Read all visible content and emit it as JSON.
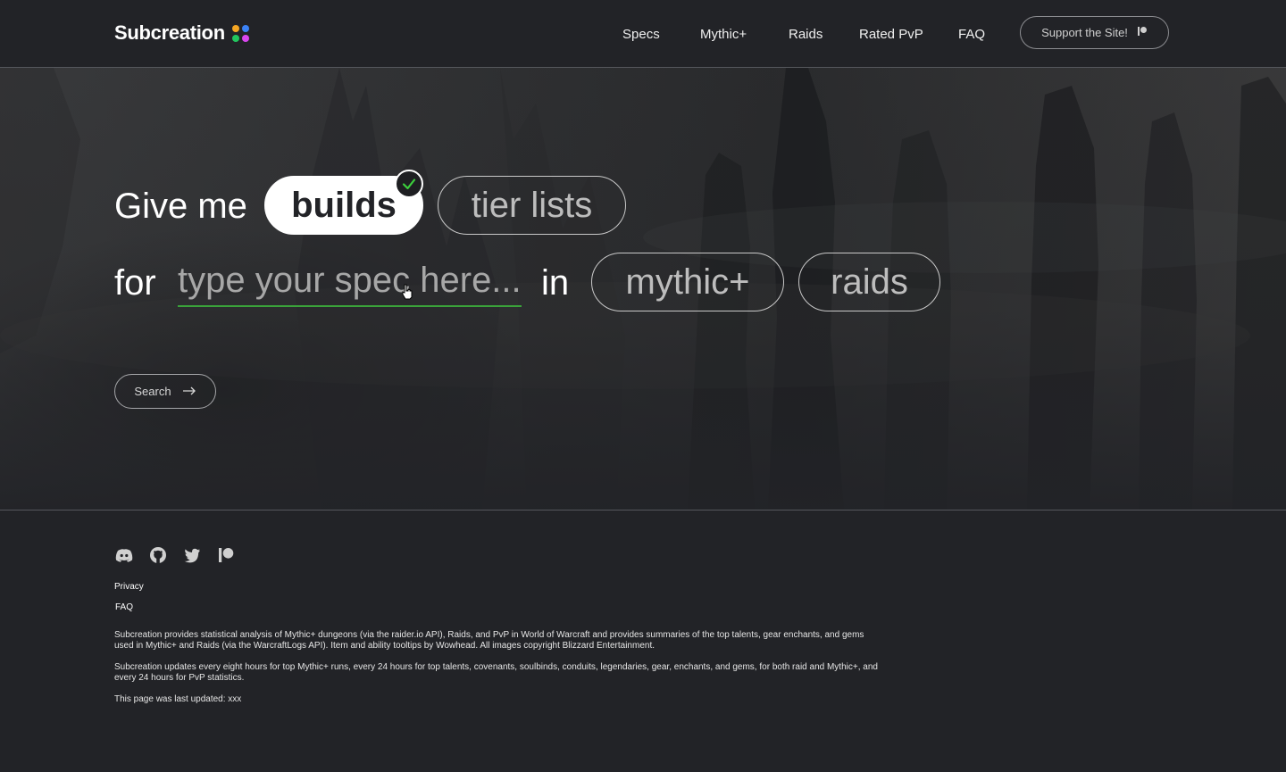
{
  "header": {
    "logo_text": "Subcreation",
    "logo_dot_colors": [
      "#f5a623",
      "#3b82f6",
      "#22c55e",
      "#d946ef"
    ],
    "nav": [
      {
        "label": "Specs"
      },
      {
        "label": "Mythic+"
      },
      {
        "label": "Raids"
      },
      {
        "label": "Rated PvP"
      },
      {
        "label": "FAQ"
      }
    ],
    "support_label": "Support the Site!",
    "support_icon": "patreon-icon"
  },
  "hero": {
    "line1_prefix": "Give me",
    "type_options": [
      {
        "label": "builds",
        "selected": true
      },
      {
        "label": "tier lists",
        "selected": false
      }
    ],
    "selected_icon": "checkmark-icon",
    "line2_prefix": "for",
    "spec_input": {
      "value": "",
      "placeholder": "type your spec here..."
    },
    "line2_mid": "in",
    "mode_options": [
      {
        "label": "mythic+",
        "selected": false
      },
      {
        "label": "raids",
        "selected": false
      }
    ],
    "search_label": "Search",
    "search_icon": "arrow-right-icon",
    "accent_color": "#3aa33a"
  },
  "footer": {
    "social_icons": [
      "discord-icon",
      "github-icon",
      "twitter-icon",
      "patreon-icon"
    ],
    "links": [
      {
        "label": "Privacy"
      },
      {
        "label": "FAQ"
      }
    ],
    "about": "Subcreation provides statistical analysis of Mythic+ dungeons (via the raider.io API), Raids, and PvP in World of Warcraft and provides summaries of the top talents, gear enchants, and gems used in Mythic+ and Raids (via the WarcraftLogs API). Item and ability tooltips by Wowhead. All images copyright Blizzard Entertainment.",
    "update_schedule": "Subcreation updates every eight hours for top Mythic+ runs, every 24 hours for top talents, covenants, soulbinds, conduits, legendaries, gear, enchants, and gems, for both raid and Mythic+, and every 24 hours for PvP statistics.",
    "last_updated": "This page was last updated: xxx"
  }
}
